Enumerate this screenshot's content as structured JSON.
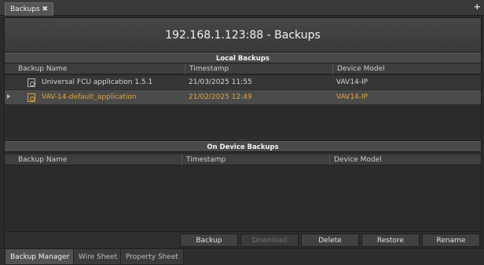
{
  "window": {
    "tab_label": "Backups",
    "tab_close": "✖",
    "add_tab": "+"
  },
  "page_title": "192.168.1.123:88 - Backups",
  "local_backups": {
    "heading": "Local Backups",
    "columns": [
      "Backup Name",
      "Timestamp",
      "Device Model"
    ],
    "rows": [
      {
        "name": "Universal FCU application 1.5.1",
        "timestamp": "21/03/2025 11:55",
        "model": "VAV14-IP",
        "selected": false
      },
      {
        "name": "VAV-14-default_application",
        "timestamp": "21/02/2025 12:49",
        "model": "VAV14-IP",
        "selected": true
      }
    ]
  },
  "splitter_grip": "....",
  "device_backups": {
    "heading": "On Device Backups",
    "columns": [
      "Backup Name",
      "Timestamp",
      "Device Model"
    ],
    "rows": []
  },
  "actions": {
    "backup": "Backup",
    "download": "Download",
    "delete": "Delete",
    "restore": "Restore",
    "rename": "Rename"
  },
  "bottom_tabs": [
    "Backup Manager",
    "Wire Sheet",
    "Property Sheet"
  ],
  "colors": {
    "selected_text": "#e0a33a",
    "background": "#2b2b2b"
  }
}
